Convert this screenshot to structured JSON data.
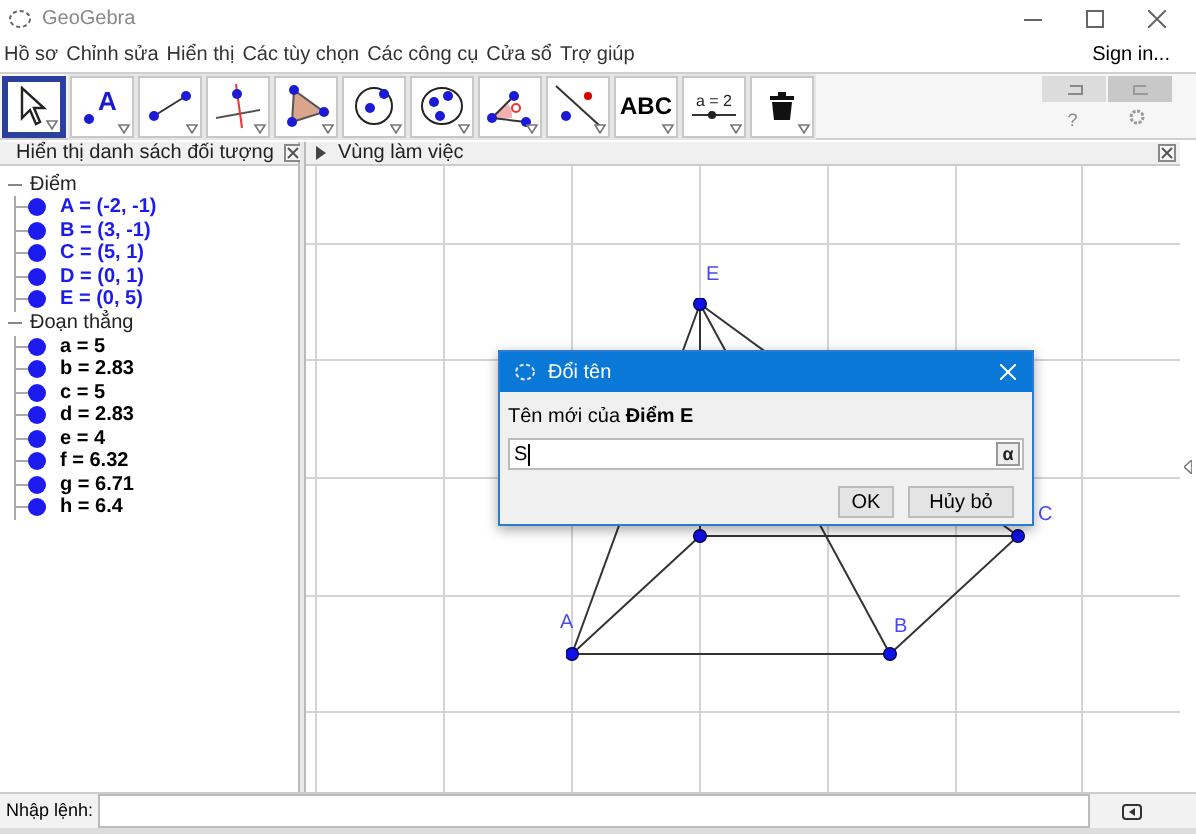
{
  "window": {
    "title": "GeoGebra"
  },
  "menu": [
    "Hồ sơ",
    "Chỉnh sửa",
    "Hiển thị",
    "Các tùy chọn",
    "Các công cụ",
    "Cửa sổ",
    "Trợ giúp"
  ],
  "sign_in": "Sign in...",
  "toolbar": [
    {
      "kind": "move",
      "selected": true
    },
    {
      "kind": "point",
      "selected": false,
      "label": "A"
    },
    {
      "kind": "segment",
      "selected": false
    },
    {
      "kind": "perpendicular",
      "selected": false
    },
    {
      "kind": "polygon",
      "selected": false
    },
    {
      "kind": "circle",
      "selected": false
    },
    {
      "kind": "ellipse",
      "selected": false
    },
    {
      "kind": "angle",
      "selected": false
    },
    {
      "kind": "reflect",
      "selected": false
    },
    {
      "kind": "text",
      "selected": false,
      "label": "ABC"
    },
    {
      "kind": "slider",
      "selected": false,
      "label": "a = 2"
    },
    {
      "kind": "delete",
      "selected": false
    }
  ],
  "help": "?",
  "algebra": {
    "title": "Hiển thị danh sách đối tượng",
    "groups": [
      {
        "name": "Điểm",
        "kind": "point",
        "items": [
          "A = (-2, -1)",
          "B = (3, -1)",
          "C = (5, 1)",
          "D = (0, 1)",
          "E = (0, 5)"
        ]
      },
      {
        "name": "Đoạn thẳng",
        "kind": "segment",
        "items": [
          "a = 5",
          "b = 2.83",
          "c = 5",
          "d = 2.83",
          "e = 4",
          "f = 6.32",
          "g = 6.71",
          "h = 6.4"
        ]
      }
    ]
  },
  "graphics": {
    "title": "Vùng làm việc",
    "labels": [
      "E",
      "A",
      "B",
      "C"
    ]
  },
  "dialog": {
    "title": "Đổi tên",
    "prompt": "Tên mới của **Điểm E**",
    "value": "S",
    "symbol": "α",
    "buttons": [
      "OK",
      "Hủy bỏ"
    ]
  },
  "input_bar": {
    "label": "Nhập lệnh:"
  }
}
